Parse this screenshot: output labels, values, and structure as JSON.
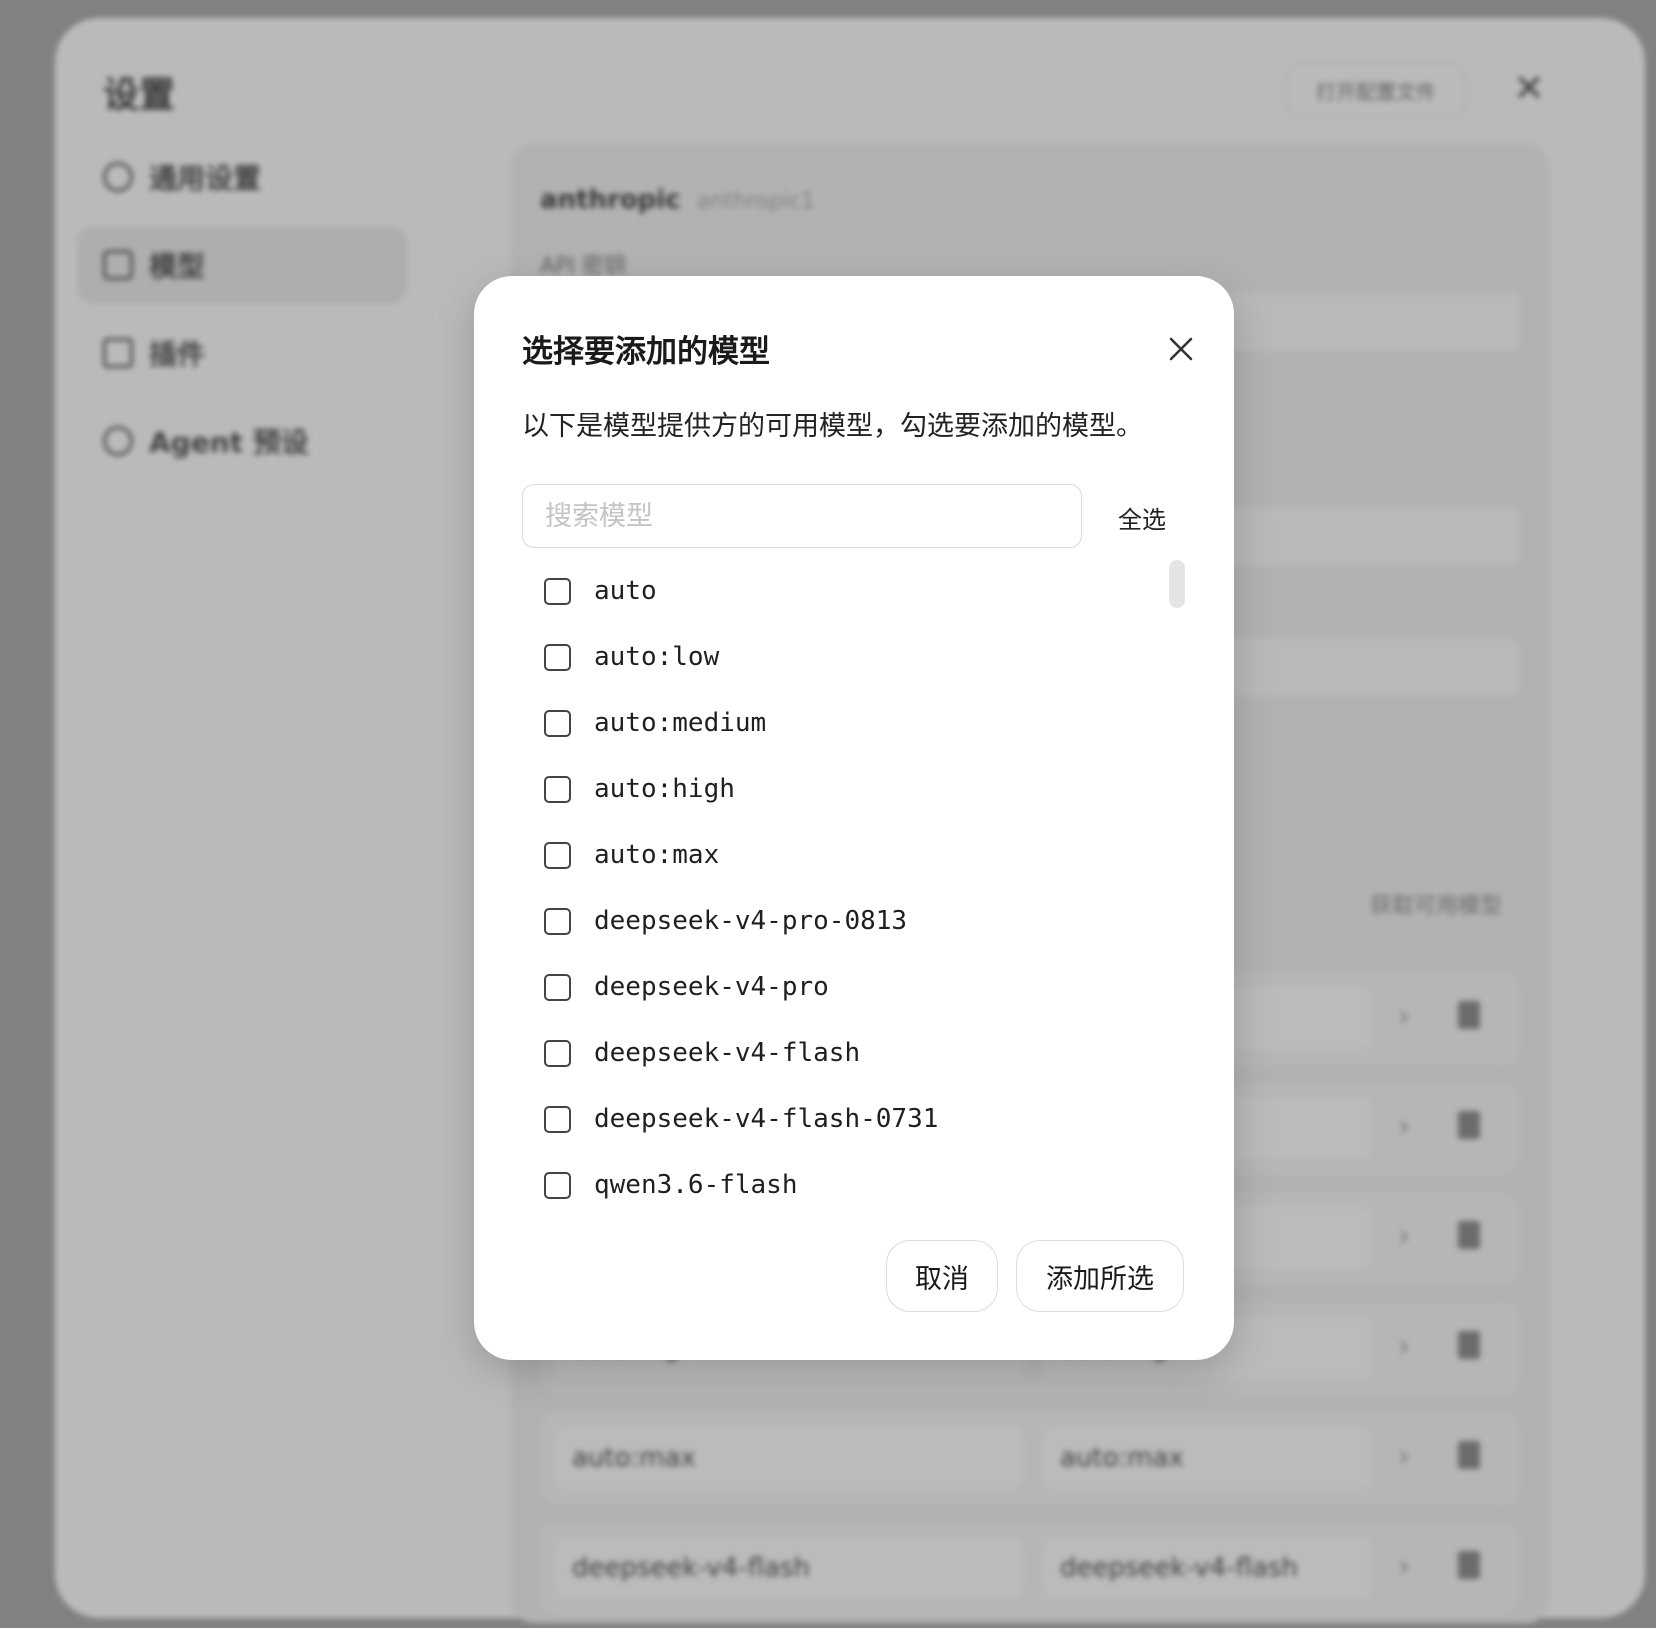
{
  "background": {
    "title": "设置",
    "open_config_button": "打开配置文件",
    "close_glyph": "✕",
    "sidebar": [
      {
        "label": "通用设置",
        "icon": "gear-icon"
      },
      {
        "label": "模型",
        "icon": "model-icon"
      },
      {
        "label": "插件",
        "icon": "plugin-icon"
      },
      {
        "label": "Agent 预设",
        "icon": "agent-icon"
      }
    ],
    "provider": {
      "name": "anthropic",
      "id": "anthropic1"
    },
    "api_key_label": "API 密钥",
    "fetch_models_link": "获取可用模型",
    "model_rows": [
      {
        "name": "auto:high",
        "alias": "auto:high"
      },
      {
        "name": "auto:max",
        "alias": "auto:max"
      },
      {
        "name": "deepseek-v4-flash",
        "alias": "deepseek-v4-flash"
      }
    ]
  },
  "dialog": {
    "title": "选择要添加的模型",
    "description": "以下是模型提供方的可用模型，勾选要添加的模型。",
    "search": {
      "placeholder": "搜索模型",
      "value": ""
    },
    "select_all_label": "全选",
    "models": [
      {
        "name": "auto",
        "checked": false
      },
      {
        "name": "auto:low",
        "checked": false
      },
      {
        "name": "auto:medium",
        "checked": false
      },
      {
        "name": "auto:high",
        "checked": false
      },
      {
        "name": "auto:max",
        "checked": false
      },
      {
        "name": "deepseek-v4-pro-0813",
        "checked": false
      },
      {
        "name": "deepseek-v4-pro",
        "checked": false
      },
      {
        "name": "deepseek-v4-flash",
        "checked": false
      },
      {
        "name": "deepseek-v4-flash-0731",
        "checked": false
      },
      {
        "name": "qwen3.6-flash",
        "checked": false
      }
    ],
    "cancel_label": "取消",
    "add_selected_label": "添加所选"
  }
}
